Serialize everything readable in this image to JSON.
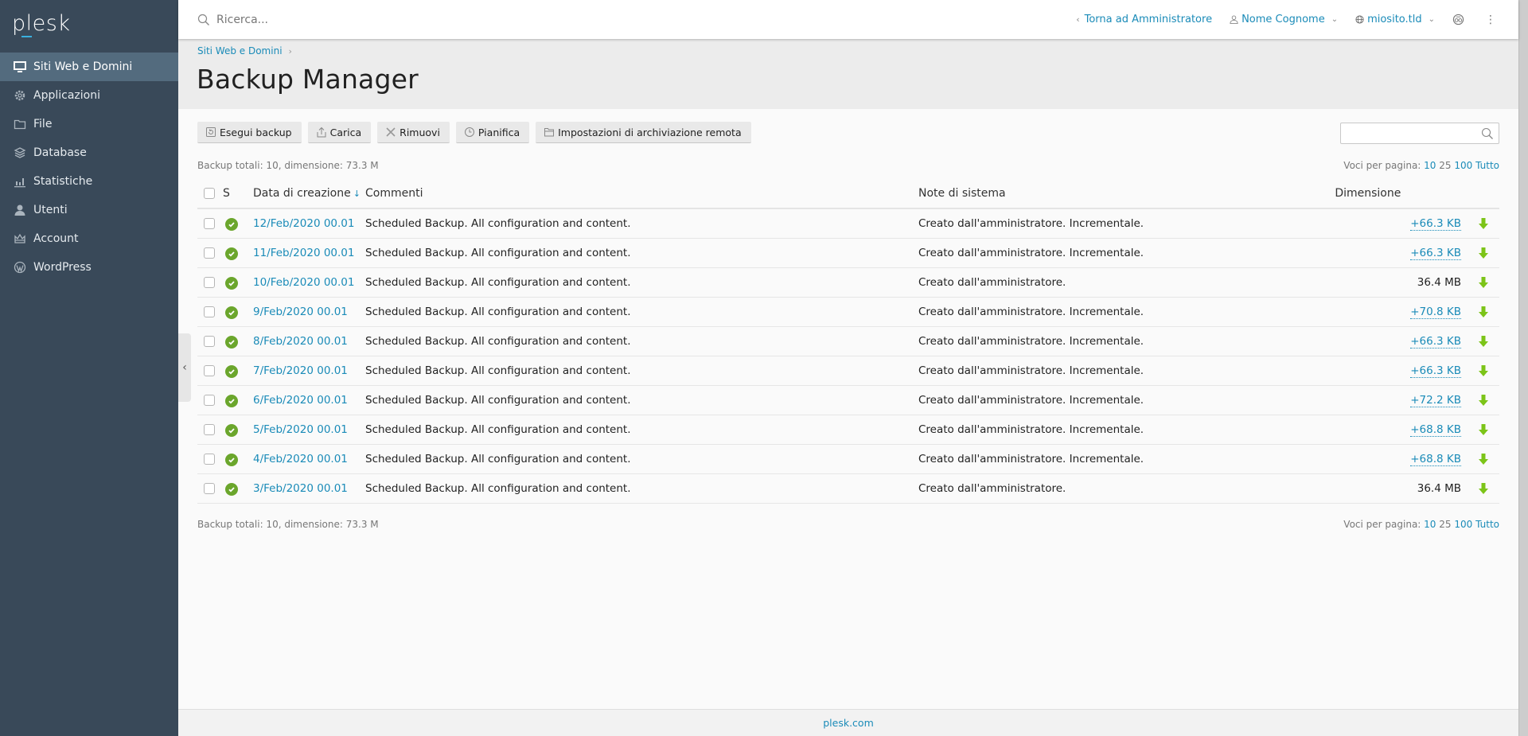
{
  "app": {
    "logo": "plesk"
  },
  "sidebar": {
    "items": [
      {
        "label": "Siti Web e Domini",
        "icon": "monitor-icon",
        "active": true
      },
      {
        "label": "Applicazioni",
        "icon": "gear-icon"
      },
      {
        "label": "File",
        "icon": "folder-icon"
      },
      {
        "label": "Database",
        "icon": "layers-icon"
      },
      {
        "label": "Statistiche",
        "icon": "bar-chart-icon"
      },
      {
        "label": "Utenti",
        "icon": "user-icon"
      },
      {
        "label": "Account",
        "icon": "crown-icon"
      },
      {
        "label": "WordPress",
        "icon": "wordpress-icon"
      }
    ]
  },
  "topbar": {
    "search_placeholder": "Ricerca...",
    "back_link": "Torna ad Amministratore",
    "user": "Nome Cognome",
    "domain": "miosito.tld"
  },
  "breadcrumb": {
    "items": [
      "Siti Web e Domini"
    ]
  },
  "page": {
    "title": "Backup Manager"
  },
  "toolbar": {
    "buttons": [
      {
        "label": "Esegui backup",
        "icon": "backup-icon"
      },
      {
        "label": "Carica",
        "icon": "upload-icon"
      },
      {
        "label": "Rimuovi",
        "icon": "remove-icon"
      },
      {
        "label": "Pianifica",
        "icon": "clock-icon"
      },
      {
        "label": "Impostazioni di archiviazione remota",
        "icon": "folder-icon"
      }
    ],
    "search_value": ""
  },
  "summary": "Backup totali: 10, dimensione: 73.3 M",
  "pagination": {
    "label": "Voci per pagina:",
    "options": [
      "10",
      "25",
      "100",
      "Tutto"
    ],
    "current": "25"
  },
  "table": {
    "columns": {
      "status": "S",
      "date": "Data di creazione",
      "comments": "Commenti",
      "notes": "Note di sistema",
      "size": "Dimensione"
    },
    "sort_indicator": "↓",
    "rows": [
      {
        "date": "12/Feb/2020 00.01",
        "comment": "Scheduled Backup. All configuration and content.",
        "notes": "Creato dall'amministratore. Incrementale.",
        "size": "+66.3 KB",
        "incremental": true,
        "status": "ok"
      },
      {
        "date": "11/Feb/2020 00.01",
        "comment": "Scheduled Backup. All configuration and content.",
        "notes": "Creato dall'amministratore. Incrementale.",
        "size": "+66.3 KB",
        "incremental": true,
        "status": "ok"
      },
      {
        "date": "10/Feb/2020 00.01",
        "comment": "Scheduled Backup. All configuration and content.",
        "notes": "Creato dall'amministratore.",
        "size": "36.4 MB",
        "incremental": false,
        "status": "ok"
      },
      {
        "date": "9/Feb/2020 00.01",
        "comment": "Scheduled Backup. All configuration and content.",
        "notes": "Creato dall'amministratore. Incrementale.",
        "size": "+70.8 KB",
        "incremental": true,
        "status": "ok"
      },
      {
        "date": "8/Feb/2020 00.01",
        "comment": "Scheduled Backup. All configuration and content.",
        "notes": "Creato dall'amministratore. Incrementale.",
        "size": "+66.3 KB",
        "incremental": true,
        "status": "ok"
      },
      {
        "date": "7/Feb/2020 00.01",
        "comment": "Scheduled Backup. All configuration and content.",
        "notes": "Creato dall'amministratore. Incrementale.",
        "size": "+66.3 KB",
        "incremental": true,
        "status": "ok"
      },
      {
        "date": "6/Feb/2020 00.01",
        "comment": "Scheduled Backup. All configuration and content.",
        "notes": "Creato dall'amministratore. Incrementale.",
        "size": "+72.2 KB",
        "incremental": true,
        "status": "ok"
      },
      {
        "date": "5/Feb/2020 00.01",
        "comment": "Scheduled Backup. All configuration and content.",
        "notes": "Creato dall'amministratore. Incrementale.",
        "size": "+68.8 KB",
        "incremental": true,
        "status": "ok"
      },
      {
        "date": "4/Feb/2020 00.01",
        "comment": "Scheduled Backup. All configuration and content.",
        "notes": "Creato dall'amministratore. Incrementale.",
        "size": "+68.8 KB",
        "incremental": true,
        "status": "ok"
      },
      {
        "date": "3/Feb/2020 00.01",
        "comment": "Scheduled Backup. All configuration and content.",
        "notes": "Creato dall'amministratore.",
        "size": "36.4 MB",
        "incremental": false,
        "status": "ok"
      }
    ]
  },
  "footer": {
    "link": "plesk.com"
  },
  "colors": {
    "sidebar": "#394959",
    "sidebar_active": "#536b7e",
    "link": "#1a8bb8",
    "success": "#6ba62c",
    "download": "#7cc418"
  }
}
